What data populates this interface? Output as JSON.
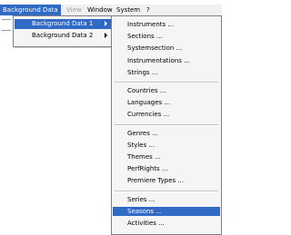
{
  "menubar": {
    "items": [
      {
        "label": "Background Data",
        "state": "active"
      },
      {
        "label": "View",
        "state": "disabled"
      },
      {
        "label": "Window",
        "state": "normal"
      },
      {
        "label": "System",
        "state": "normal"
      },
      {
        "label": "?",
        "state": "normal"
      }
    ]
  },
  "background_submenu": {
    "items": [
      {
        "label": "Background Data 1",
        "highlighted": true
      },
      {
        "label": "Background Data 2",
        "highlighted": false
      }
    ]
  },
  "data1_menu": {
    "groups": [
      [
        "Instruments ...",
        "Sections ...",
        "Systemsection ...",
        "Instrumentations ...",
        "Strings ..."
      ],
      [
        "Countries ...",
        "Languages ...",
        "Currencies ..."
      ],
      [
        "Genres ...",
        "Styles ...",
        "Themes ...",
        "PerfRights ...",
        "Premiere Types ..."
      ],
      [
        "Series ...",
        "Seasons ...",
        "Activities ..."
      ]
    ],
    "highlighted": "Seasons ..."
  },
  "colors": {
    "highlight": "#316ac5",
    "menu_bg": "#f5f5f5",
    "menubar_bg": "#f0f0f0"
  }
}
